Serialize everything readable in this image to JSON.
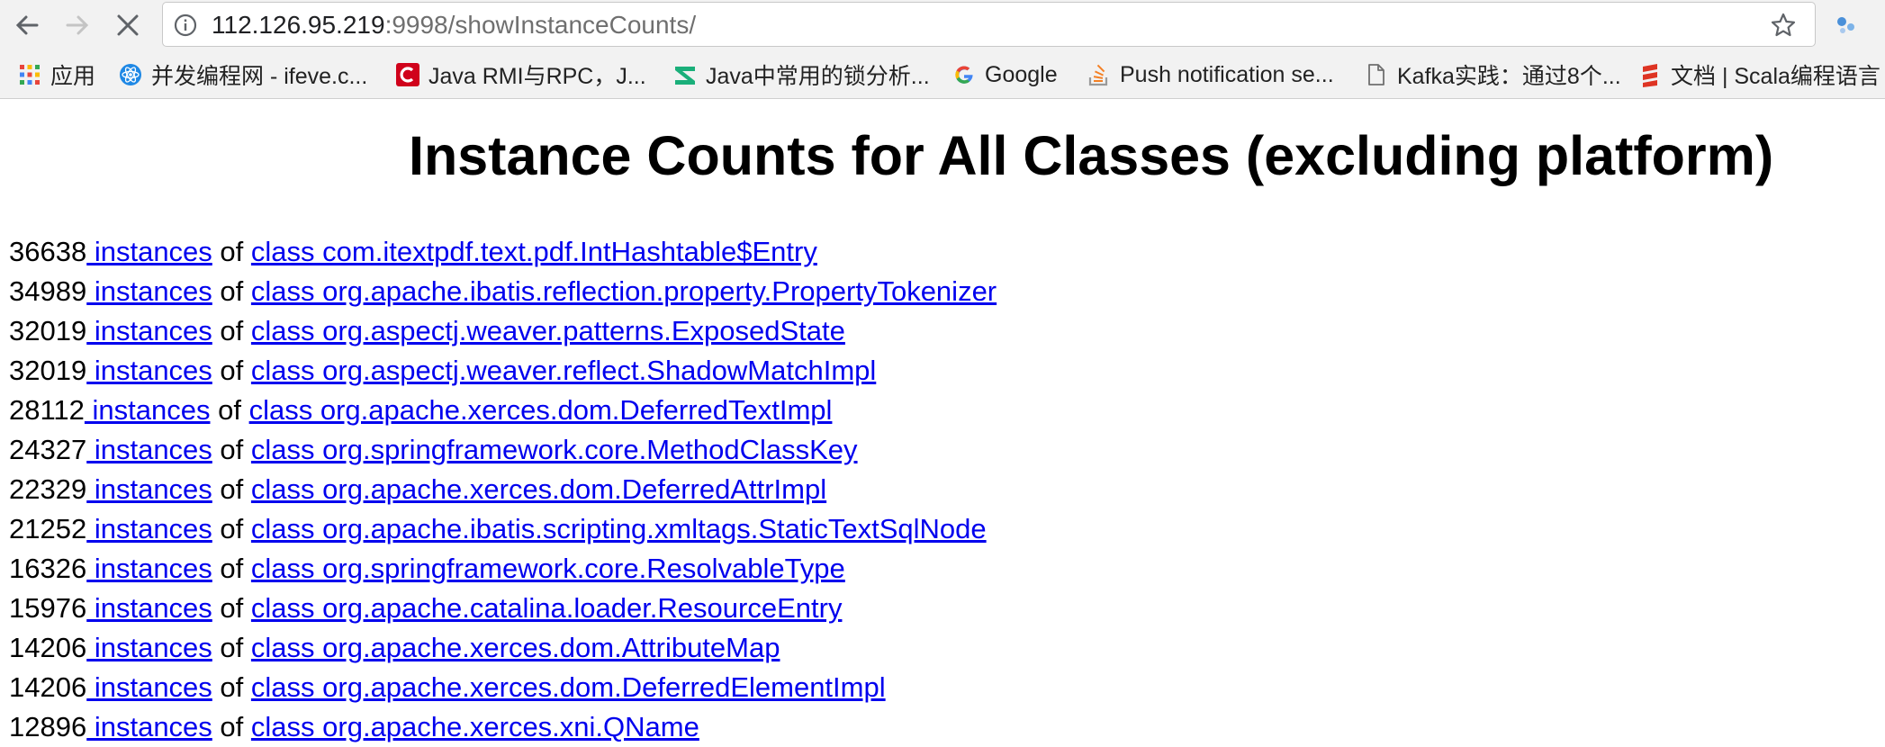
{
  "browser": {
    "url_host": "112.126.95.219",
    "url_rest": ":9998/showInstanceCounts/",
    "bookmarks": [
      {
        "label": "应用",
        "icon": "apps-grid-icon"
      },
      {
        "label": "并发编程网 - ifeve.c...",
        "icon": "react-logo-icon"
      },
      {
        "label": "Java RMI与RPC，J...",
        "icon": "red-c-logo-icon"
      },
      {
        "label": "Java中常用的锁分析...",
        "icon": "green-logo-icon"
      },
      {
        "label": "Google",
        "icon": "google-logo-icon"
      },
      {
        "label": "Push notification se...",
        "icon": "stackoverflow-icon"
      },
      {
        "label": "Kafka实践：通过8个...",
        "icon": "document-icon"
      },
      {
        "label": "文档 | Scala编程语言",
        "icon": "scala-logo-icon"
      }
    ]
  },
  "page": {
    "title": "Instance Counts for All Classes (excluding platform)",
    "of_text": "of",
    "rows": [
      {
        "count": "36638",
        "link": " instances",
        "cls": "class com.itextpdf.text.pdf.IntHashtable$Entry"
      },
      {
        "count": "34989",
        "link": " instances",
        "cls": "class org.apache.ibatis.reflection.property.PropertyTokenizer"
      },
      {
        "count": "32019",
        "link": " instances",
        "cls": "class org.aspectj.weaver.patterns.ExposedState"
      },
      {
        "count": "32019",
        "link": " instances",
        "cls": "class org.aspectj.weaver.reflect.ShadowMatchImpl"
      },
      {
        "count": "28112",
        "link": " instances",
        "cls": "class org.apache.xerces.dom.DeferredTextImpl"
      },
      {
        "count": "24327",
        "link": " instances",
        "cls": "class org.springframework.core.MethodClassKey"
      },
      {
        "count": "22329",
        "link": " instances",
        "cls": "class org.apache.xerces.dom.DeferredAttrImpl"
      },
      {
        "count": "21252",
        "link": " instances",
        "cls": "class org.apache.ibatis.scripting.xmltags.StaticTextSqlNode"
      },
      {
        "count": "16326",
        "link": " instances",
        "cls": "class org.springframework.core.ResolvableType"
      },
      {
        "count": "15976",
        "link": " instances",
        "cls": "class org.apache.catalina.loader.ResourceEntry"
      },
      {
        "count": "14206",
        "link": " instances",
        "cls": "class org.apache.xerces.dom.AttributeMap"
      },
      {
        "count": "14206",
        "link": " instances",
        "cls": "class org.apache.xerces.dom.DeferredElementImpl"
      },
      {
        "count": "12896",
        "link": " instances",
        "cls": "class org.apache.xerces.xni.QName"
      }
    ]
  }
}
